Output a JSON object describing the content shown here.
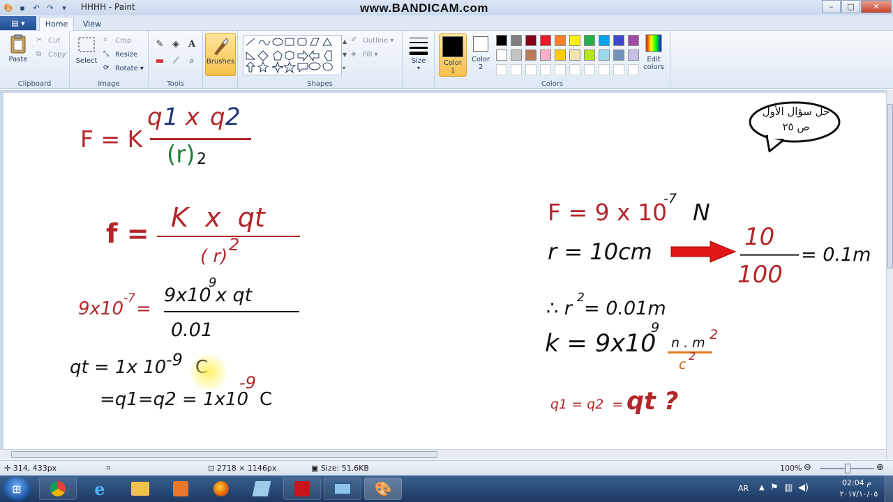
{
  "window": {
    "title": "HHHH - Paint",
    "watermark": "www.BANDICAM.com",
    "buttons": {
      "minimize": "–",
      "maximize": "□",
      "close": "✕"
    }
  },
  "tabs": {
    "file": "▤ ▾",
    "home": "Home",
    "view": "View"
  },
  "ribbon": {
    "clipboard": {
      "label": "Clipboard",
      "paste": "Paste",
      "cut": "Cut",
      "copy": "Copy"
    },
    "image": {
      "label": "Image",
      "select": "Select",
      "crop": "Crop",
      "resize": "Resize",
      "rotate": "Rotate"
    },
    "tools": {
      "label": "Tools"
    },
    "brushes": {
      "label": "Brushes"
    },
    "shapes": {
      "label": "Shapes",
      "outline": "Outline",
      "fill": "Fill"
    },
    "size": {
      "label": "Size"
    },
    "colors": {
      "label": "Colors",
      "color1": "Color 1",
      "color2": "Color 2",
      "edit": "Edit colors",
      "palette_row1": [
        "#000000",
        "#7f7f7f",
        "#880015",
        "#ed1c24",
        "#ff7f27",
        "#fff200",
        "#22b14c",
        "#00a2e8",
        "#3f48cc",
        "#a349a4"
      ],
      "palette_row2": [
        "#ffffff",
        "#c3c3c3",
        "#b97a57",
        "#ffaec9",
        "#ffc90e",
        "#efe4b0",
        "#b5e61d",
        "#99d9ea",
        "#7092be",
        "#c8bfe7"
      ],
      "color1_value": "#000000",
      "color2_value": "#ffffff"
    }
  },
  "canvas": {
    "eq1": {
      "lhs": "F = K",
      "num_q1": "q",
      "num_1": "1",
      "num_x": " x ",
      "num_q2": "q",
      "num_2": "2",
      "den_r": "(r)",
      "den_sub": "2"
    },
    "eq2": {
      "lhs": "f =",
      "num": "K  x  qt",
      "den_r": "( r)",
      "den_exp": "2"
    },
    "eq3": {
      "lhs_base": "9x10",
      "lhs_exp": "-7",
      "lhs_eq": "=",
      "num_a": "9x10",
      "num_exp": "9",
      "num_b": "x qt",
      "den": "0.01"
    },
    "eq4": {
      "text": "qt = 1x 10",
      "exp": "-9",
      "unit": "C"
    },
    "eq5": {
      "text": "=q1=q2 = 1x10",
      "exp": "-9",
      "unit": "C"
    },
    "given_F": {
      "base": "F = 9 x 10",
      "exp": "-7",
      "unit": "N"
    },
    "given_r": {
      "text": "r = 10cm",
      "frac_num": "10",
      "frac_den": "100",
      "result": "= 0.1m"
    },
    "r_squared": {
      "a": "∴ r",
      "exp": "2",
      "b": "= 0.01m"
    },
    "k_value": {
      "base": "k = 9x10",
      "exp": "9",
      "unit_num": "n . m",
      "unit_num_exp": "2",
      "unit_den": "c",
      "unit_den_exp": "2"
    },
    "question": {
      "small": "q1 = q2  =",
      "big": "qt ?"
    },
    "bubble": {
      "line1": "حل سؤال الأول",
      "line2": "ص ٢٥"
    }
  },
  "status": {
    "cursor": "314, 433px",
    "dimensions": "2718 × 1146px",
    "size": "Size: 51.6KB",
    "zoom": "100%"
  },
  "taskbar": {
    "lang": "AR",
    "time": "02:04 م",
    "date": "٢٠١٧/١٠/٠٥"
  }
}
